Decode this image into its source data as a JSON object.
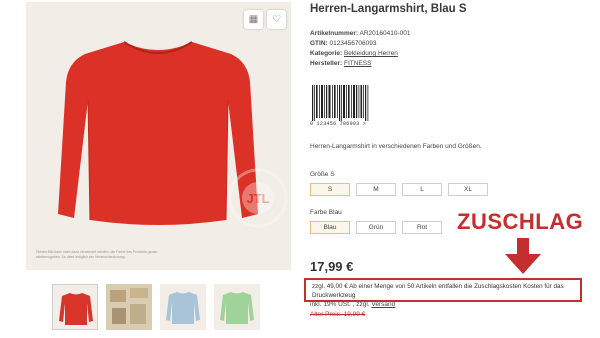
{
  "gallery": {
    "note": "Dieses Bild kann nicht dazu verwendet werden, die Farbe des Produkts genau wiederzugeben. Es dient lediglich der Veranschaulichung.",
    "watermark": "JTL",
    "icons": [
      "grid-icon",
      "heart-icon"
    ],
    "thumbnails": [
      {
        "name": "thumb-red-shirt",
        "color": "#d8342a"
      },
      {
        "name": "thumb-printed",
        "color": "#c9b89a"
      },
      {
        "name": "thumb-blue-shirt",
        "color": "#a9c4d8"
      },
      {
        "name": "thumb-green-shirt",
        "color": "#9fd39a"
      }
    ],
    "shirt_color": "#dc3127"
  },
  "product": {
    "title": "Herren-Langarmshirt, Blau S",
    "sku_label": "Artikelnummer:",
    "sku": "AR20160410-001",
    "gtin_label": "GTIN:",
    "gtin": "0123456706093",
    "category_label": "Kategorie:",
    "category": "Bekleidung Herren",
    "manufacturer_label": "Hersteller:",
    "manufacturer": "FITNESS",
    "barcode_number": "0 123456 706093 >",
    "description": "Herren-Langarmshirt in verschiedenen Farben und Größen."
  },
  "options": {
    "size_label": "Größe S",
    "sizes": [
      "S",
      "M",
      "L",
      "XL"
    ],
    "size_selected": "S",
    "color_label": "Farbe Blau",
    "colors": [
      "Blau",
      "Grün",
      "Rot"
    ],
    "color_selected": "Blau"
  },
  "pricing": {
    "price": "17,99 €",
    "surcharge_text": "zzgl. 49,00 € Ab einer Menge von 50 Artikeln entfallen die Zuschlagskosten Kosten für das Druckwerkzeug",
    "vat_text": "inkl. 19% USt. , zzgl.",
    "shipping_link": "Versand",
    "old_price": "Alter Preis: 19,99 €"
  },
  "annotation": {
    "label": "ZUSCHLAG",
    "color": "#c42e2e"
  }
}
